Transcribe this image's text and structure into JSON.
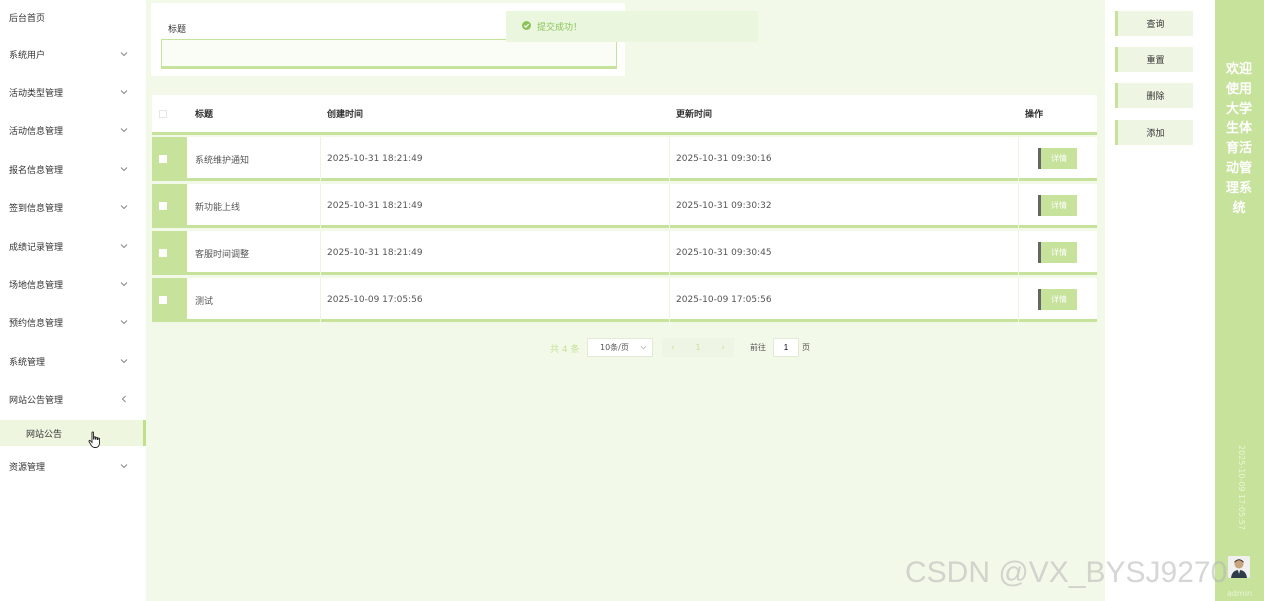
{
  "sidebar": {
    "items": [
      {
        "label": "后台首页",
        "has_chevron": false
      },
      {
        "label": "系统用户",
        "has_chevron": true
      },
      {
        "label": "活动类型管理",
        "has_chevron": true
      },
      {
        "label": "活动信息管理",
        "has_chevron": true
      },
      {
        "label": "报名信息管理",
        "has_chevron": true
      },
      {
        "label": "签到信息管理",
        "has_chevron": true
      },
      {
        "label": "成绩记录管理",
        "has_chevron": true
      },
      {
        "label": "场地信息管理",
        "has_chevron": true
      },
      {
        "label": "预约信息管理",
        "has_chevron": true
      },
      {
        "label": "系统管理",
        "has_chevron": true
      },
      {
        "label": "网站公告管理",
        "has_chevron": true
      },
      {
        "label": "资源管理",
        "has_chevron": true
      }
    ],
    "active_submenu": "网站公告"
  },
  "search": {
    "label": "标题",
    "value": "",
    "placeholder": ""
  },
  "toast": {
    "message": "提交成功！",
    "icon": "check-circle-icon"
  },
  "table": {
    "headers": {
      "title": "标题",
      "created": "创建时间",
      "updated": "更新时间",
      "action": "操作"
    },
    "rows": [
      {
        "title": "系统维护通知",
        "created": "2025-10-31 18:21:49",
        "updated": "2025-10-31 09:30:16",
        "action": "详情"
      },
      {
        "title": "新功能上线",
        "created": "2025-10-31 18:21:49",
        "updated": "2025-10-31 09:30:32",
        "action": "详情"
      },
      {
        "title": "客服时间调整",
        "created": "2025-10-31 18:21:49",
        "updated": "2025-10-31 09:30:45",
        "action": "详情"
      },
      {
        "title": "测试",
        "created": "2025-10-09 17:05:56",
        "updated": "2025-10-09 17:05:56",
        "action": "详情"
      }
    ]
  },
  "pagination": {
    "total": "共 4 条",
    "page_size": "10条/页",
    "prev": "‹",
    "current": "1",
    "next": "›",
    "goto_label": "前往",
    "goto_value": "1",
    "page_suffix": "页"
  },
  "actions": {
    "query": "查询",
    "reset": "重置",
    "delete": "删除",
    "add": "添加"
  },
  "titlebar": {
    "title": "欢迎使用大学生体育活动管理系统",
    "datetime": "2025-10-09 17:05:57",
    "username": "admin"
  },
  "watermark": "CSDN @VX_BYSJ9270",
  "colors": {
    "accent": "#c6e29b",
    "main_bg": "#f3f9e9",
    "toast_text": "#8cc45a"
  }
}
